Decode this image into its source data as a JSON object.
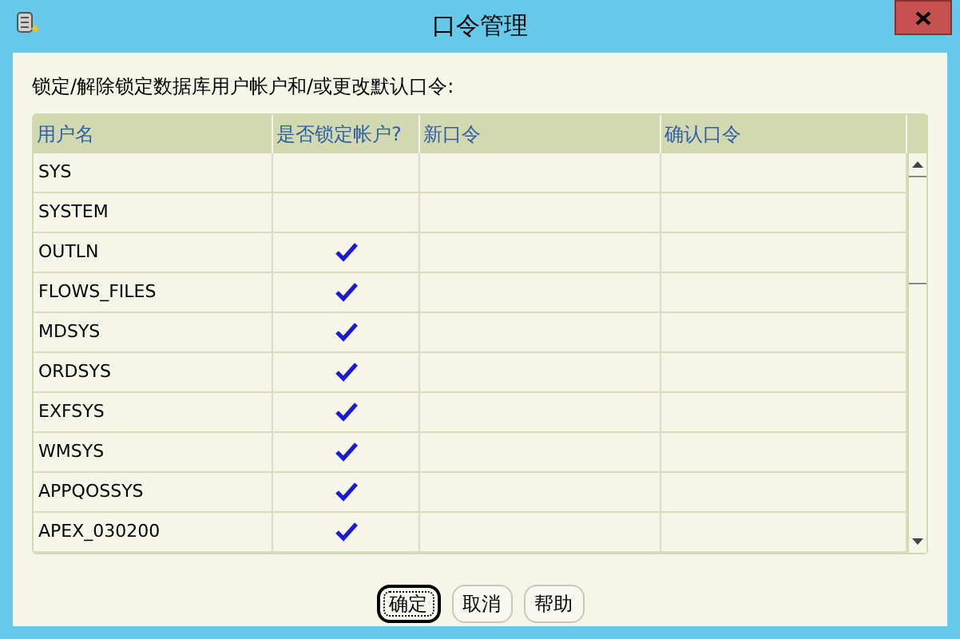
{
  "window": {
    "title": "口令管理"
  },
  "instruction": "锁定/解除锁定数据库用户帐户和/或更改默认口令:",
  "table": {
    "columns": [
      "用户名",
      "是否锁定帐户?",
      "新口令",
      "确认口令"
    ],
    "rows": [
      {
        "username": "SYS",
        "locked": false
      },
      {
        "username": "SYSTEM",
        "locked": false
      },
      {
        "username": "OUTLN",
        "locked": true
      },
      {
        "username": "FLOWS_FILES",
        "locked": true
      },
      {
        "username": "MDSYS",
        "locked": true
      },
      {
        "username": "ORDSYS",
        "locked": true
      },
      {
        "username": "EXFSYS",
        "locked": true
      },
      {
        "username": "WMSYS",
        "locked": true
      },
      {
        "username": "APPQOSSYS",
        "locked": true
      },
      {
        "username": "APEX_030200",
        "locked": true
      }
    ]
  },
  "buttons": [
    {
      "label": "确定",
      "default": true
    },
    {
      "label": "取消",
      "default": false
    },
    {
      "label": "帮助",
      "default": false
    }
  ]
}
